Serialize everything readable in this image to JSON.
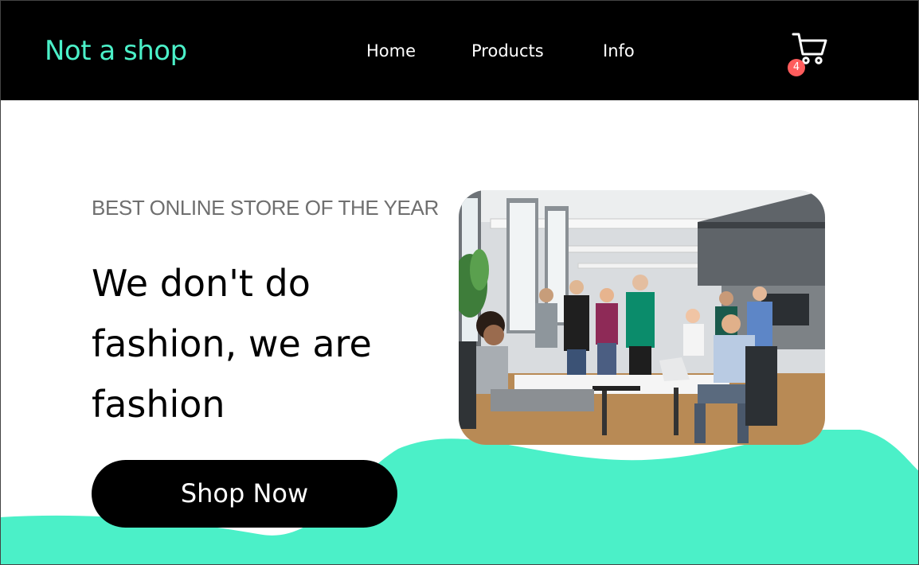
{
  "nav": {
    "logo": "Not a shop",
    "links": [
      {
        "label": "Home"
      },
      {
        "label": "Products"
      },
      {
        "label": "Info"
      }
    ],
    "cart": {
      "icon": "shopping-cart-icon",
      "count": "4"
    }
  },
  "hero": {
    "eyebrow": "BEST ONLINE STORE OF THE YEAR",
    "headline": "We don't do fashion, we are fashion",
    "cta_label": "Shop Now",
    "image": "team-in-office-photo"
  },
  "colors": {
    "accent": "#4bf0c8",
    "navbar": "#000000",
    "badge": "#ff5c5c",
    "button": "#000000"
  }
}
